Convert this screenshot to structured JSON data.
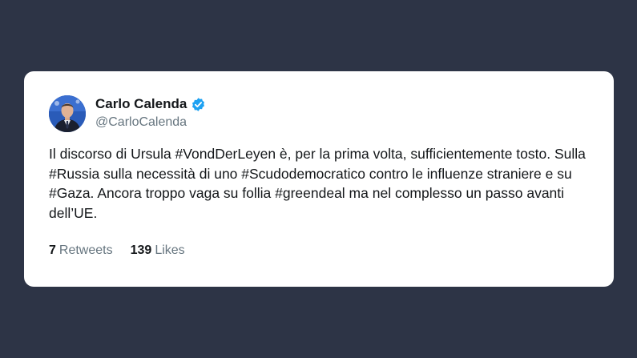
{
  "tweet": {
    "author": {
      "name": "Carlo Calenda",
      "handle": "@CarloCalenda",
      "verified_icon": "verified-badge-icon",
      "verified_color": "#1da1f2"
    },
    "text": "Il discorso di Ursula #VondDerLeyen è, per la prima volta, sufficientemente tosto. Sulla #Russia sulla necessità di uno #Scudodemocratico contro le influenze straniere e su #Gaza. Ancora troppo vaga su follia #greendeal ma nel complesso un passo avanti dell’UE.",
    "stats": {
      "retweets_count": "7",
      "retweets_label": "Retweets",
      "likes_count": "139",
      "likes_label": "Likes"
    }
  },
  "colors": {
    "background": "#2d3446",
    "card": "#ffffff",
    "primary_text": "#14171a",
    "secondary_text": "#66757f"
  }
}
